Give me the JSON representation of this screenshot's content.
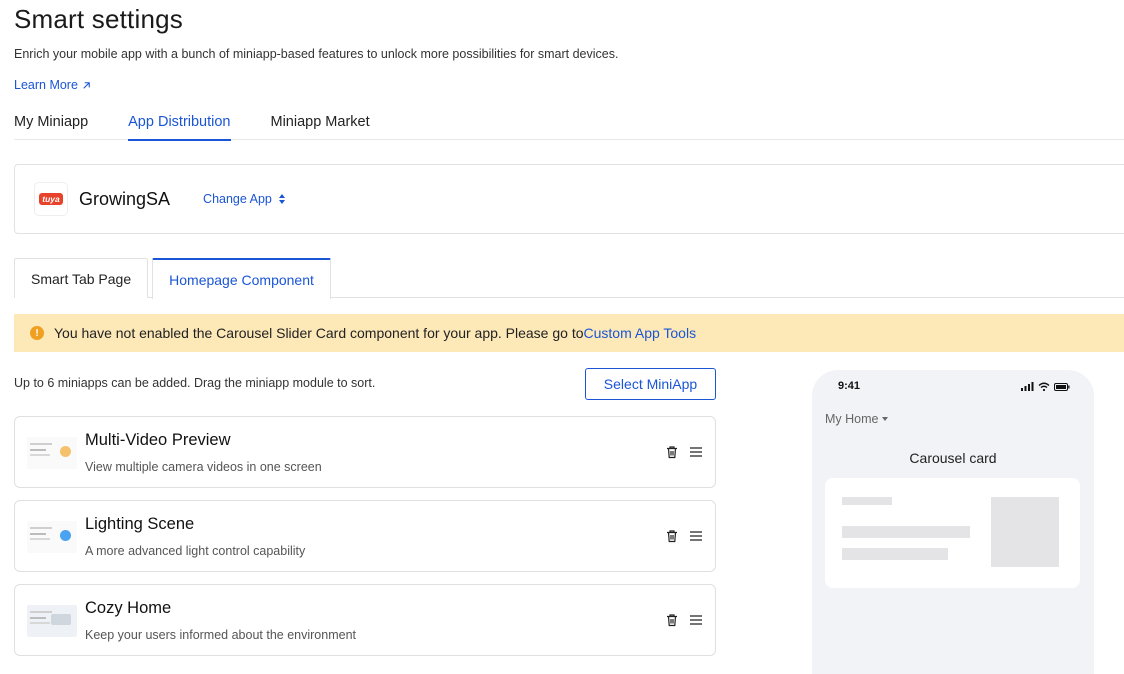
{
  "page": {
    "title": "Smart settings",
    "description": "Enrich your mobile app with a bunch of miniapp-based features to unlock more possibilities for smart devices.",
    "learn_more": "Learn More"
  },
  "main_tabs": [
    {
      "label": "My Miniapp",
      "active": false
    },
    {
      "label": "App Distribution",
      "active": true
    },
    {
      "label": "Miniapp Market",
      "active": false
    }
  ],
  "app": {
    "logo_text": "tuya",
    "name": "GrowingSA",
    "change_label": "Change App"
  },
  "sub_tabs": [
    {
      "label": "Smart Tab Page",
      "active": false
    },
    {
      "label": "Homepage Component",
      "active": true
    }
  ],
  "alert": {
    "message": "You have not enabled the Carousel Slider Card component for your app. Please go to",
    "link": "Custom App Tools"
  },
  "list_hint": "Up to 6 miniapps can be added. Drag the miniapp module to sort.",
  "select_button": "Select MiniApp",
  "miniapps": [
    {
      "title": "Multi-Video Preview",
      "description": "View multiple camera videos in one screen",
      "accent": "#f5c26b"
    },
    {
      "title": "Lighting Scene",
      "description": "A more advanced light control capability",
      "accent": "#4aa3f0"
    },
    {
      "title": "Cozy Home",
      "description": "Keep your users informed about the environment",
      "accent": "#d0d6de"
    }
  ],
  "preview": {
    "time": "9:41",
    "home_label": "My Home",
    "carousel_label": "Carousel card"
  },
  "colors": {
    "accent": "#1a55d6",
    "alert_bg": "#fde9b8",
    "alert_icon": "#f0a020"
  }
}
